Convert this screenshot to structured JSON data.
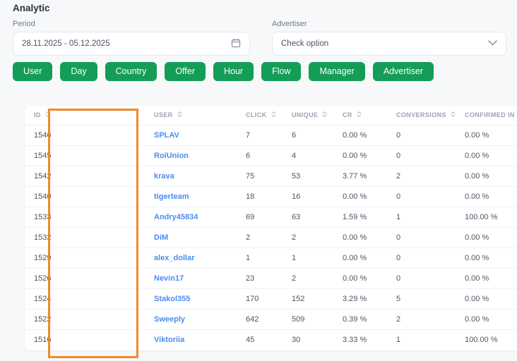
{
  "page": {
    "title": "Analytic"
  },
  "filters": {
    "period": {
      "label": "Period",
      "value": "28.11.2025  -  05.12.2025"
    },
    "advertiser": {
      "label": "Advertiser",
      "value": "Check option"
    }
  },
  "report_buttons": [
    "User",
    "Day",
    "Country",
    "Offer",
    "Hour",
    "Flow",
    "Manager",
    "Advertiser"
  ],
  "table": {
    "columns": [
      "ID",
      "USER",
      "CLICK",
      "UNIQUE",
      "CR",
      "CONVERSIONS",
      "CONFIRMED IN PERCEN"
    ],
    "rows": [
      {
        "id": "1546",
        "user": "SPLAV",
        "click": "7",
        "unique": "6",
        "cr": "0.00 %",
        "conversions": "0",
        "confirmed": "0.00 %"
      },
      {
        "id": "1545",
        "user": "RoiUnion",
        "click": "6",
        "unique": "4",
        "cr": "0.00 %",
        "conversions": "0",
        "confirmed": "0.00 %"
      },
      {
        "id": "1542",
        "user": "krava",
        "click": "75",
        "unique": "53",
        "cr": "3.77 %",
        "conversions": "2",
        "confirmed": "0.00 %"
      },
      {
        "id": "1540",
        "user": "tigerteam",
        "click": "18",
        "unique": "16",
        "cr": "0.00 %",
        "conversions": "0",
        "confirmed": "0.00 %"
      },
      {
        "id": "1533",
        "user": "Andry45834",
        "click": "69",
        "unique": "63",
        "cr": "1.59 %",
        "conversions": "1",
        "confirmed": "100.00 %"
      },
      {
        "id": "1532",
        "user": "DiM",
        "click": "2",
        "unique": "2",
        "cr": "0.00 %",
        "conversions": "0",
        "confirmed": "0.00 %"
      },
      {
        "id": "1529",
        "user": "alex_dollar",
        "click": "1",
        "unique": "1",
        "cr": "0.00 %",
        "conversions": "0",
        "confirmed": "0.00 %"
      },
      {
        "id": "1526",
        "user": "Nevin17",
        "click": "23",
        "unique": "2",
        "cr": "0.00 %",
        "conversions": "0",
        "confirmed": "0.00 %"
      },
      {
        "id": "1524",
        "user": "Stakol355",
        "click": "170",
        "unique": "152",
        "cr": "3.29 %",
        "conversions": "5",
        "confirmed": "0.00 %"
      },
      {
        "id": "1522",
        "user": "Sweeply",
        "click": "642",
        "unique": "509",
        "cr": "0.39 %",
        "conversions": "2",
        "confirmed": "0.00 %"
      },
      {
        "id": "1516",
        "user": "Viktoriia",
        "click": "45",
        "unique": "30",
        "cr": "3.33 %",
        "conversions": "1",
        "confirmed": "100.00 %"
      }
    ]
  },
  "annotation": {
    "type": "highlight-box",
    "color": "#f08929"
  },
  "colors": {
    "accent_green": "#149d57",
    "link_blue": "#4a8df0",
    "background": "#f7f8fa"
  }
}
